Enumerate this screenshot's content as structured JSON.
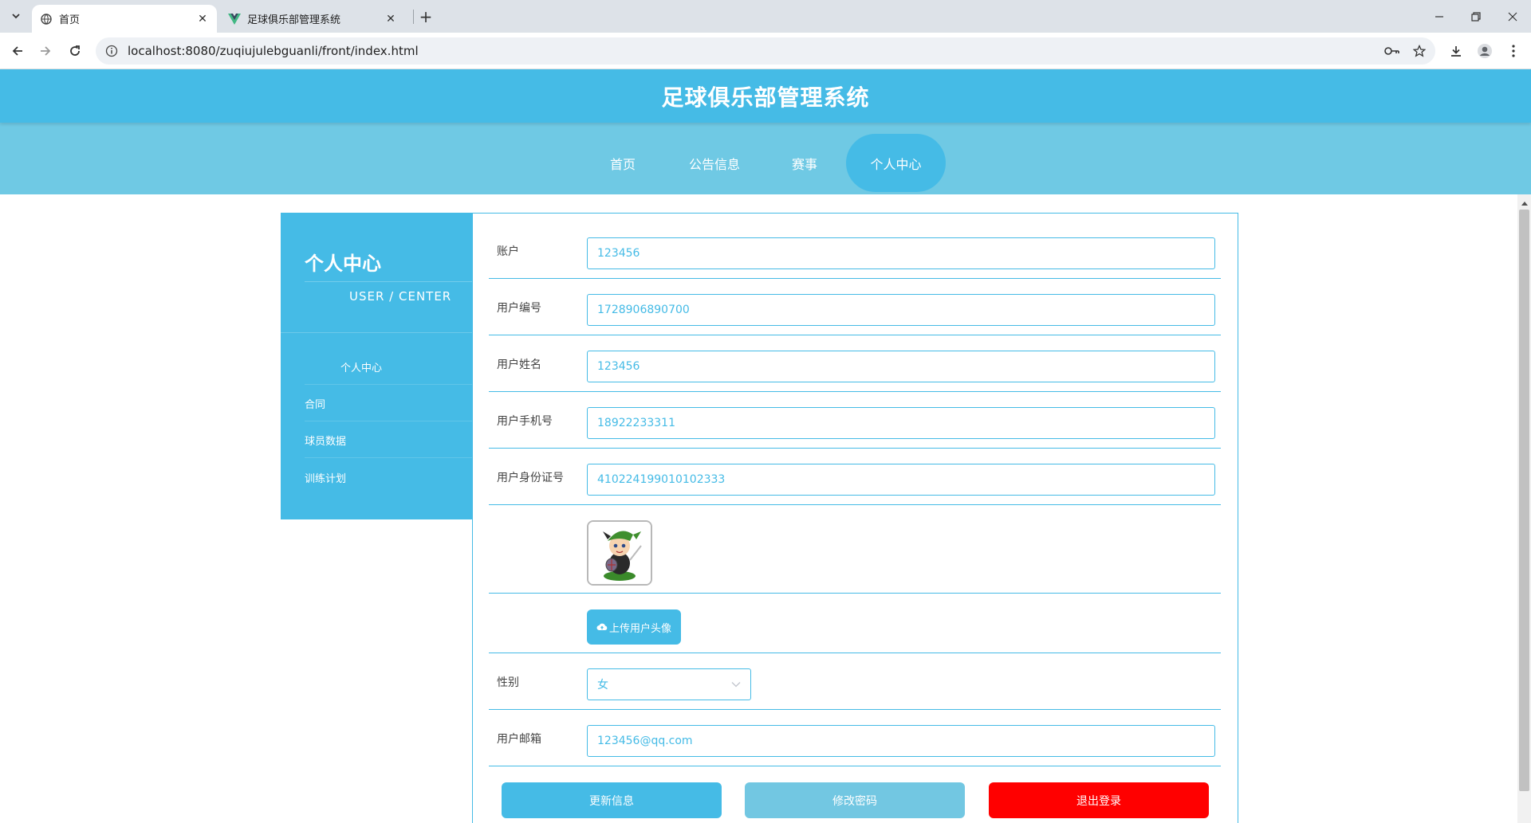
{
  "browser": {
    "tabs": [
      {
        "title": "首页",
        "active": true,
        "icon": "globe-icon"
      },
      {
        "title": "足球俱乐部管理系统",
        "active": false,
        "icon": "vue-logo-icon"
      }
    ],
    "new_tab": "+",
    "url": "localhost:8080/zuqiujulebguanli/front/index.html"
  },
  "site": {
    "title": "足球俱乐部管理系统",
    "nav": [
      {
        "label": "首页",
        "active": false
      },
      {
        "label": "公告信息",
        "active": false
      },
      {
        "label": "赛事",
        "active": false
      },
      {
        "label": "个人中心",
        "active": true
      }
    ]
  },
  "sidebar": {
    "title": "个人中心",
    "subtitle": "USER / CENTER",
    "items": [
      {
        "label": "个人中心"
      },
      {
        "label": "合同"
      },
      {
        "label": "球员数据"
      },
      {
        "label": "训练计划"
      }
    ]
  },
  "form": {
    "account": {
      "label": "账户",
      "value": "123456"
    },
    "user_no": {
      "label": "用户编号",
      "value": "1728906890700"
    },
    "user_name": {
      "label": "用户姓名",
      "value": "123456"
    },
    "phone": {
      "label": "用户手机号",
      "value": "18922233311"
    },
    "id_card": {
      "label": "用户身份证号",
      "value": "410224199010102333"
    },
    "upload_label": "上传用户头像",
    "gender": {
      "label": "性别",
      "value": "女"
    },
    "email": {
      "label": "用户邮箱",
      "value": "123456@qq.com"
    }
  },
  "actions": {
    "update": "更新信息",
    "change_password": "修改密码",
    "logout": "退出登录"
  },
  "colors": {
    "primary": "#45bbe6",
    "nav_bg": "#6fc9e4",
    "logout": "#ff0000",
    "secondary_button": "#72c7e2"
  }
}
